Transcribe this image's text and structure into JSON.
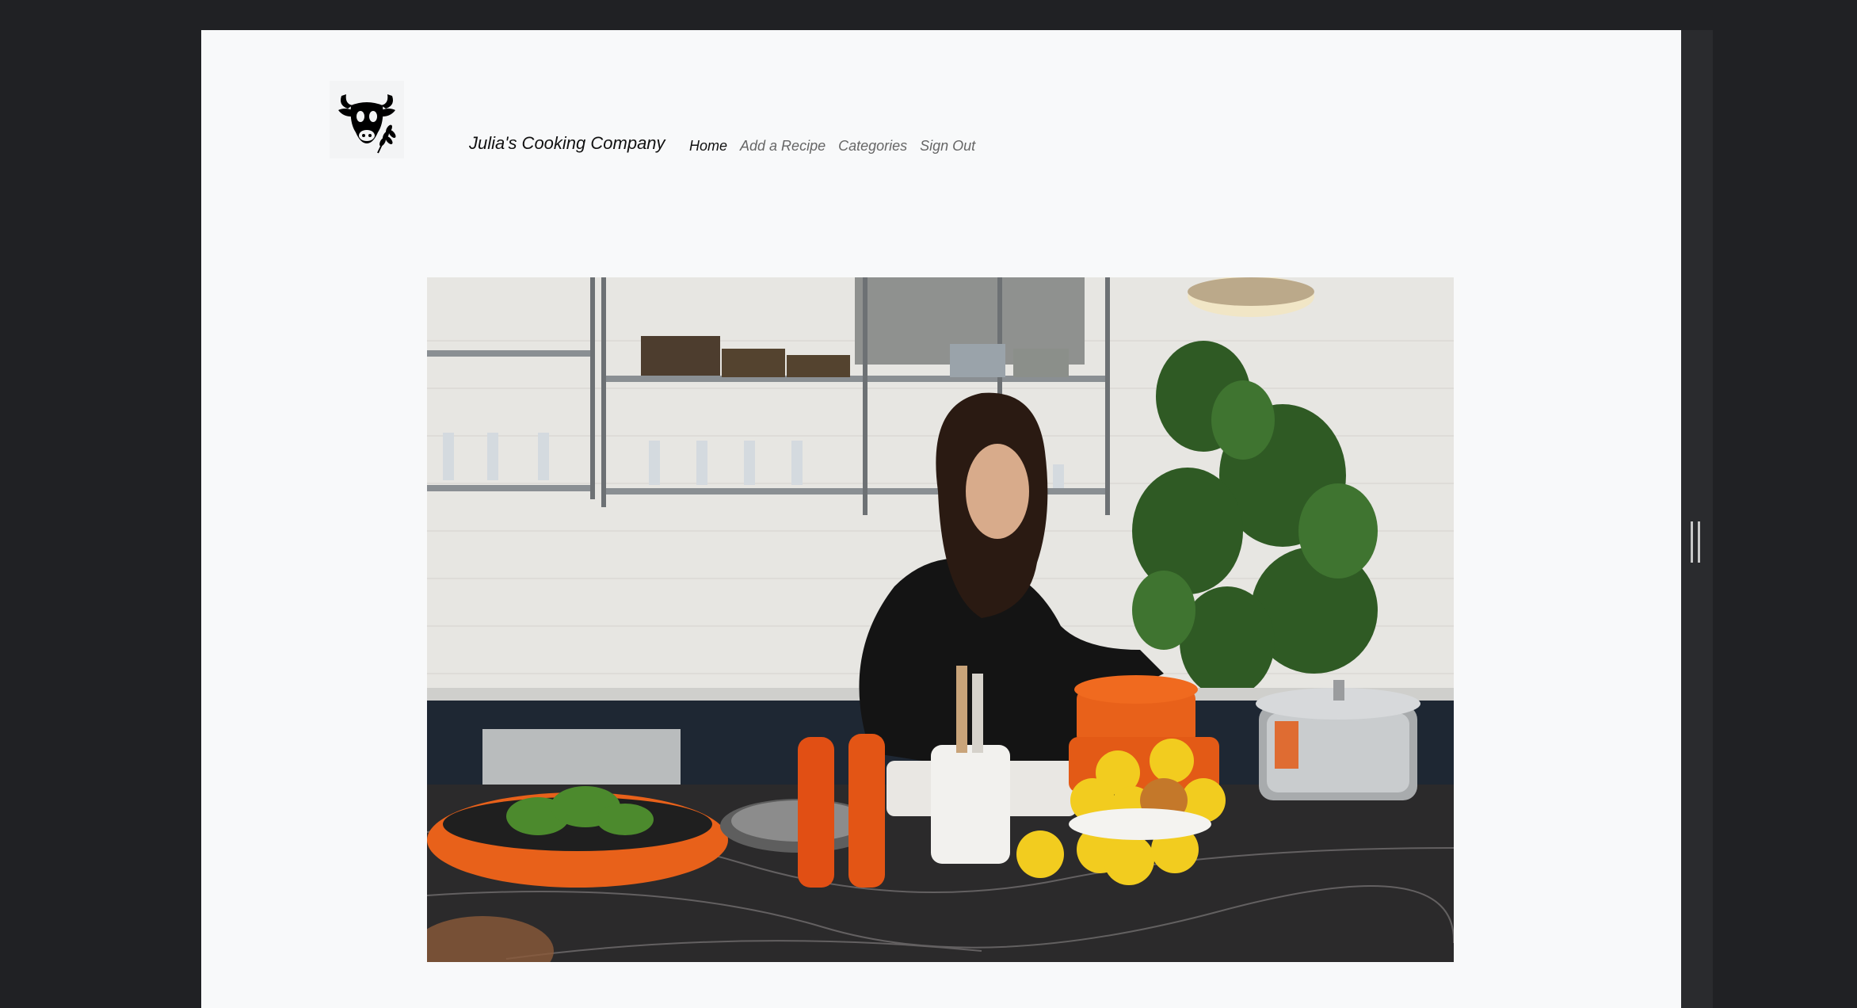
{
  "brand": {
    "name": "Julia's Cooking Company",
    "logo_icon": "cow-with-wheat-icon"
  },
  "nav": {
    "items": [
      {
        "label": "Home",
        "active": true
      },
      {
        "label": "Add a Recipe",
        "active": false
      },
      {
        "label": "Categories",
        "active": false
      },
      {
        "label": "Sign Out",
        "active": false
      }
    ]
  },
  "hero": {
    "image_icon": "kitchen-photo"
  },
  "colors": {
    "page_bg": "#f8f9fa",
    "window_bg": "#202124",
    "accent_orange": "#e8611a",
    "lemon": "#f2cc1f"
  }
}
